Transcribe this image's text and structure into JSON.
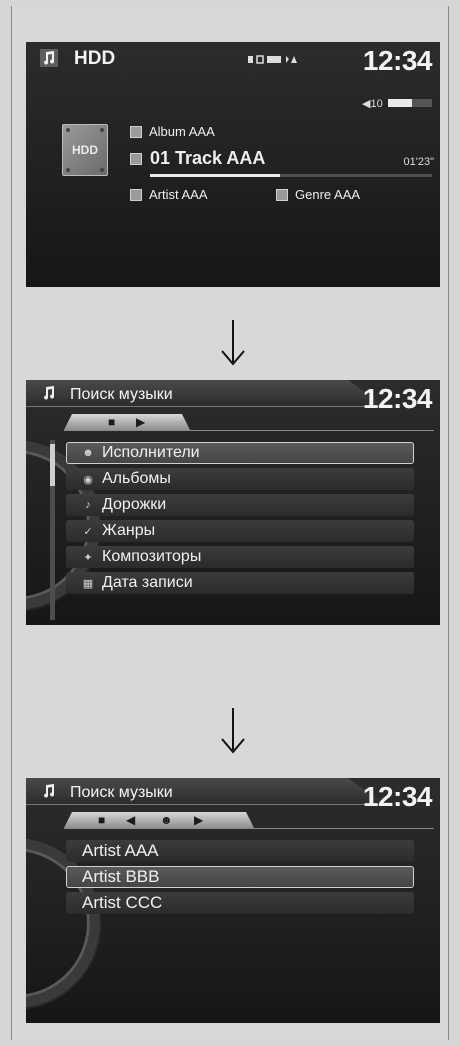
{
  "player": {
    "source": "HDD",
    "clock": "12:34",
    "volume_label": "◀10",
    "volume_level": 0.55,
    "hdd_badge": "HDD",
    "album": "Album AAA",
    "track": "01 Track AAA",
    "elapsed": "01'23\"",
    "progress": 0.46,
    "artist": "Artist AAA",
    "genre": "Genre AAA"
  },
  "search_menu": {
    "title": "Поиск музыки",
    "clock": "12:34",
    "items": [
      {
        "icon": "artists-icon",
        "label": "Исполнители"
      },
      {
        "icon": "albums-icon",
        "label": "Альбомы"
      },
      {
        "icon": "tracks-icon",
        "label": "Дорожки"
      },
      {
        "icon": "genres-icon",
        "label": "Жанры"
      },
      {
        "icon": "composers-icon",
        "label": "Композиторы"
      },
      {
        "icon": "record-date-icon",
        "label": "Дата записи"
      }
    ],
    "selected_index": 0
  },
  "artist_list": {
    "title": "Поиск музыки",
    "clock": "12:34",
    "items": [
      "Artist AAA",
      "Artist BBB",
      "Artist CCC"
    ],
    "selected_index": 1
  },
  "colors": {
    "background": "#d6d6d6",
    "screen": "#1f1f1f",
    "text": "#f2f2f2"
  }
}
